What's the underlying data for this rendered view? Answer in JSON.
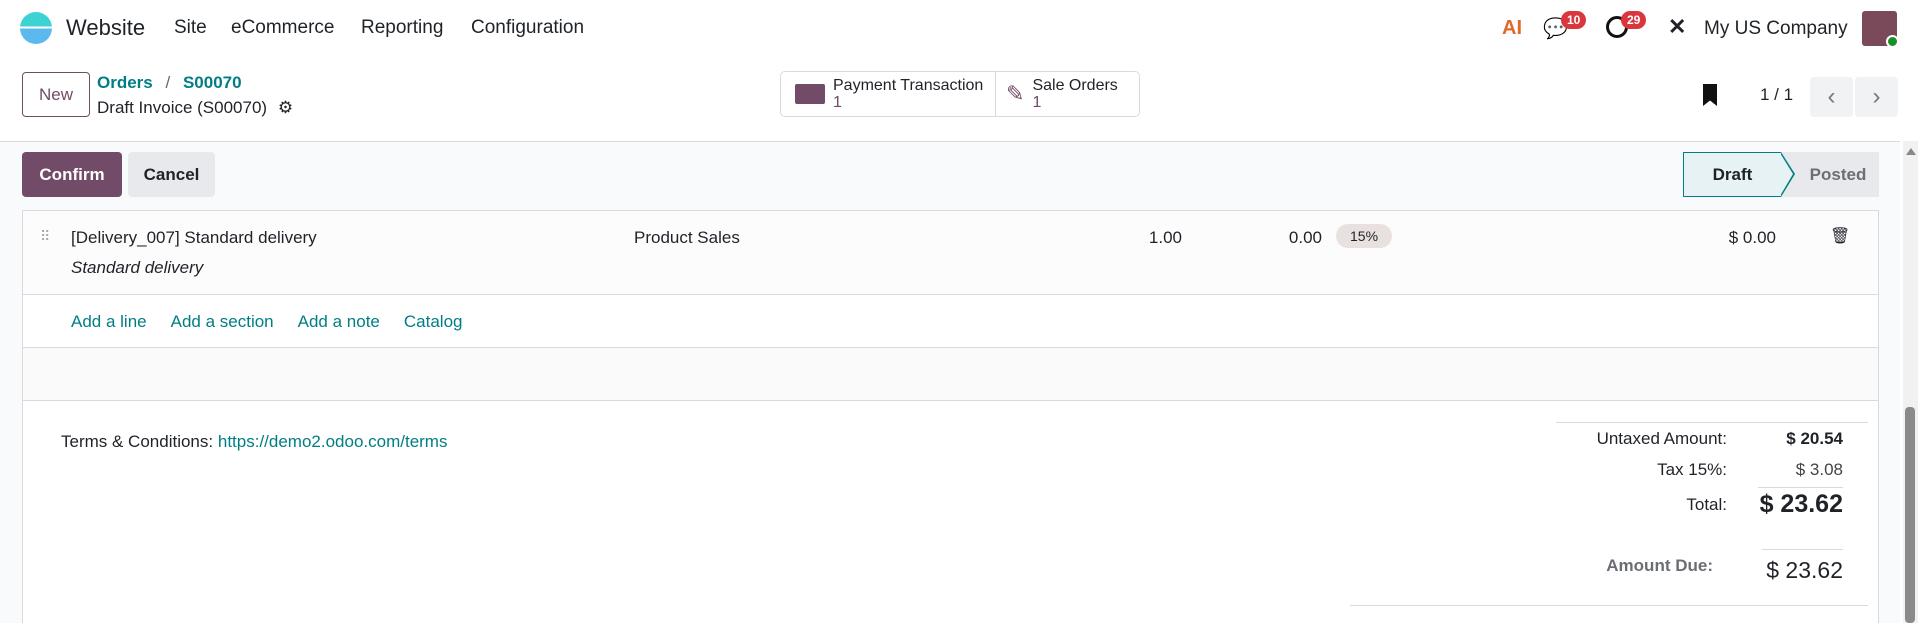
{
  "navbar": {
    "app_name": "Website",
    "menu": [
      "Site",
      "eCommerce",
      "Reporting",
      "Configuration"
    ],
    "messages_count": "10",
    "activities_count": "29",
    "company": "My US Company",
    "ai_label": "AI"
  },
  "control_panel": {
    "new_label": "New",
    "breadcrumb": [
      "Orders",
      "S00070"
    ],
    "separator": "/",
    "record_title": "Draft Invoice (S00070)",
    "smart_buttons": [
      {
        "label": "Payment Transaction",
        "value": "1",
        "icon": "money-icon"
      },
      {
        "label": "Sale Orders",
        "value": "1",
        "icon": "edit-icon"
      }
    ],
    "pager": "1 / 1"
  },
  "status_bar": {
    "confirm_label": "Confirm",
    "cancel_label": "Cancel",
    "stages": [
      "Draft",
      "Posted"
    ],
    "active_stage": "Draft"
  },
  "lines": [
    {
      "product": "[Delivery_007] Standard delivery",
      "description": "Standard delivery",
      "account": "Product Sales",
      "quantity": "1.00",
      "price": "0.00",
      "tax": "15%",
      "subtotal": "$ 0.00"
    }
  ],
  "line_actions": [
    "Add a line",
    "Add a section",
    "Add a note",
    "Catalog"
  ],
  "terms": {
    "label": "Terms & Conditions:",
    "link": "https://demo2.odoo.com/terms"
  },
  "totals": {
    "untaxed_label": "Untaxed Amount:",
    "untaxed": "$ 20.54",
    "tax_label": "Tax 15%:",
    "tax": "$ 3.08",
    "total_label": "Total:",
    "total": "$ 23.62",
    "due_label": "Amount Due:",
    "due": "$ 23.62"
  },
  "colors": {
    "primary": "#714b67",
    "link": "#017e84",
    "danger": "#d9363e"
  }
}
